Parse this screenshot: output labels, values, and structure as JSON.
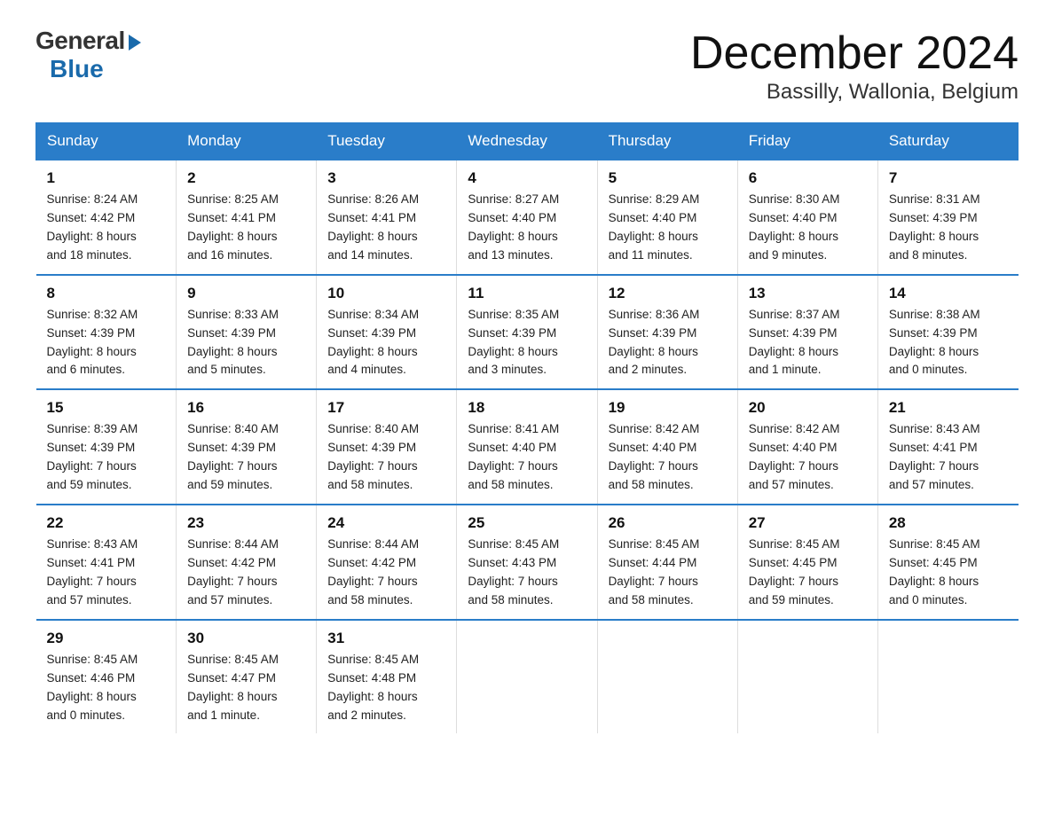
{
  "logo": {
    "general": "General",
    "blue": "Blue"
  },
  "title": "December 2024",
  "location": "Bassilly, Wallonia, Belgium",
  "headers": [
    "Sunday",
    "Monday",
    "Tuesday",
    "Wednesday",
    "Thursday",
    "Friday",
    "Saturday"
  ],
  "weeks": [
    [
      {
        "day": "1",
        "info": "Sunrise: 8:24 AM\nSunset: 4:42 PM\nDaylight: 8 hours\nand 18 minutes."
      },
      {
        "day": "2",
        "info": "Sunrise: 8:25 AM\nSunset: 4:41 PM\nDaylight: 8 hours\nand 16 minutes."
      },
      {
        "day": "3",
        "info": "Sunrise: 8:26 AM\nSunset: 4:41 PM\nDaylight: 8 hours\nand 14 minutes."
      },
      {
        "day": "4",
        "info": "Sunrise: 8:27 AM\nSunset: 4:40 PM\nDaylight: 8 hours\nand 13 minutes."
      },
      {
        "day": "5",
        "info": "Sunrise: 8:29 AM\nSunset: 4:40 PM\nDaylight: 8 hours\nand 11 minutes."
      },
      {
        "day": "6",
        "info": "Sunrise: 8:30 AM\nSunset: 4:40 PM\nDaylight: 8 hours\nand 9 minutes."
      },
      {
        "day": "7",
        "info": "Sunrise: 8:31 AM\nSunset: 4:39 PM\nDaylight: 8 hours\nand 8 minutes."
      }
    ],
    [
      {
        "day": "8",
        "info": "Sunrise: 8:32 AM\nSunset: 4:39 PM\nDaylight: 8 hours\nand 6 minutes."
      },
      {
        "day": "9",
        "info": "Sunrise: 8:33 AM\nSunset: 4:39 PM\nDaylight: 8 hours\nand 5 minutes."
      },
      {
        "day": "10",
        "info": "Sunrise: 8:34 AM\nSunset: 4:39 PM\nDaylight: 8 hours\nand 4 minutes."
      },
      {
        "day": "11",
        "info": "Sunrise: 8:35 AM\nSunset: 4:39 PM\nDaylight: 8 hours\nand 3 minutes."
      },
      {
        "day": "12",
        "info": "Sunrise: 8:36 AM\nSunset: 4:39 PM\nDaylight: 8 hours\nand 2 minutes."
      },
      {
        "day": "13",
        "info": "Sunrise: 8:37 AM\nSunset: 4:39 PM\nDaylight: 8 hours\nand 1 minute."
      },
      {
        "day": "14",
        "info": "Sunrise: 8:38 AM\nSunset: 4:39 PM\nDaylight: 8 hours\nand 0 minutes."
      }
    ],
    [
      {
        "day": "15",
        "info": "Sunrise: 8:39 AM\nSunset: 4:39 PM\nDaylight: 7 hours\nand 59 minutes."
      },
      {
        "day": "16",
        "info": "Sunrise: 8:40 AM\nSunset: 4:39 PM\nDaylight: 7 hours\nand 59 minutes."
      },
      {
        "day": "17",
        "info": "Sunrise: 8:40 AM\nSunset: 4:39 PM\nDaylight: 7 hours\nand 58 minutes."
      },
      {
        "day": "18",
        "info": "Sunrise: 8:41 AM\nSunset: 4:40 PM\nDaylight: 7 hours\nand 58 minutes."
      },
      {
        "day": "19",
        "info": "Sunrise: 8:42 AM\nSunset: 4:40 PM\nDaylight: 7 hours\nand 58 minutes."
      },
      {
        "day": "20",
        "info": "Sunrise: 8:42 AM\nSunset: 4:40 PM\nDaylight: 7 hours\nand 57 minutes."
      },
      {
        "day": "21",
        "info": "Sunrise: 8:43 AM\nSunset: 4:41 PM\nDaylight: 7 hours\nand 57 minutes."
      }
    ],
    [
      {
        "day": "22",
        "info": "Sunrise: 8:43 AM\nSunset: 4:41 PM\nDaylight: 7 hours\nand 57 minutes."
      },
      {
        "day": "23",
        "info": "Sunrise: 8:44 AM\nSunset: 4:42 PM\nDaylight: 7 hours\nand 57 minutes."
      },
      {
        "day": "24",
        "info": "Sunrise: 8:44 AM\nSunset: 4:42 PM\nDaylight: 7 hours\nand 58 minutes."
      },
      {
        "day": "25",
        "info": "Sunrise: 8:45 AM\nSunset: 4:43 PM\nDaylight: 7 hours\nand 58 minutes."
      },
      {
        "day": "26",
        "info": "Sunrise: 8:45 AM\nSunset: 4:44 PM\nDaylight: 7 hours\nand 58 minutes."
      },
      {
        "day": "27",
        "info": "Sunrise: 8:45 AM\nSunset: 4:45 PM\nDaylight: 7 hours\nand 59 minutes."
      },
      {
        "day": "28",
        "info": "Sunrise: 8:45 AM\nSunset: 4:45 PM\nDaylight: 8 hours\nand 0 minutes."
      }
    ],
    [
      {
        "day": "29",
        "info": "Sunrise: 8:45 AM\nSunset: 4:46 PM\nDaylight: 8 hours\nand 0 minutes."
      },
      {
        "day": "30",
        "info": "Sunrise: 8:45 AM\nSunset: 4:47 PM\nDaylight: 8 hours\nand 1 minute."
      },
      {
        "day": "31",
        "info": "Sunrise: 8:45 AM\nSunset: 4:48 PM\nDaylight: 8 hours\nand 2 minutes."
      },
      {
        "day": "",
        "info": ""
      },
      {
        "day": "",
        "info": ""
      },
      {
        "day": "",
        "info": ""
      },
      {
        "day": "",
        "info": ""
      }
    ]
  ]
}
